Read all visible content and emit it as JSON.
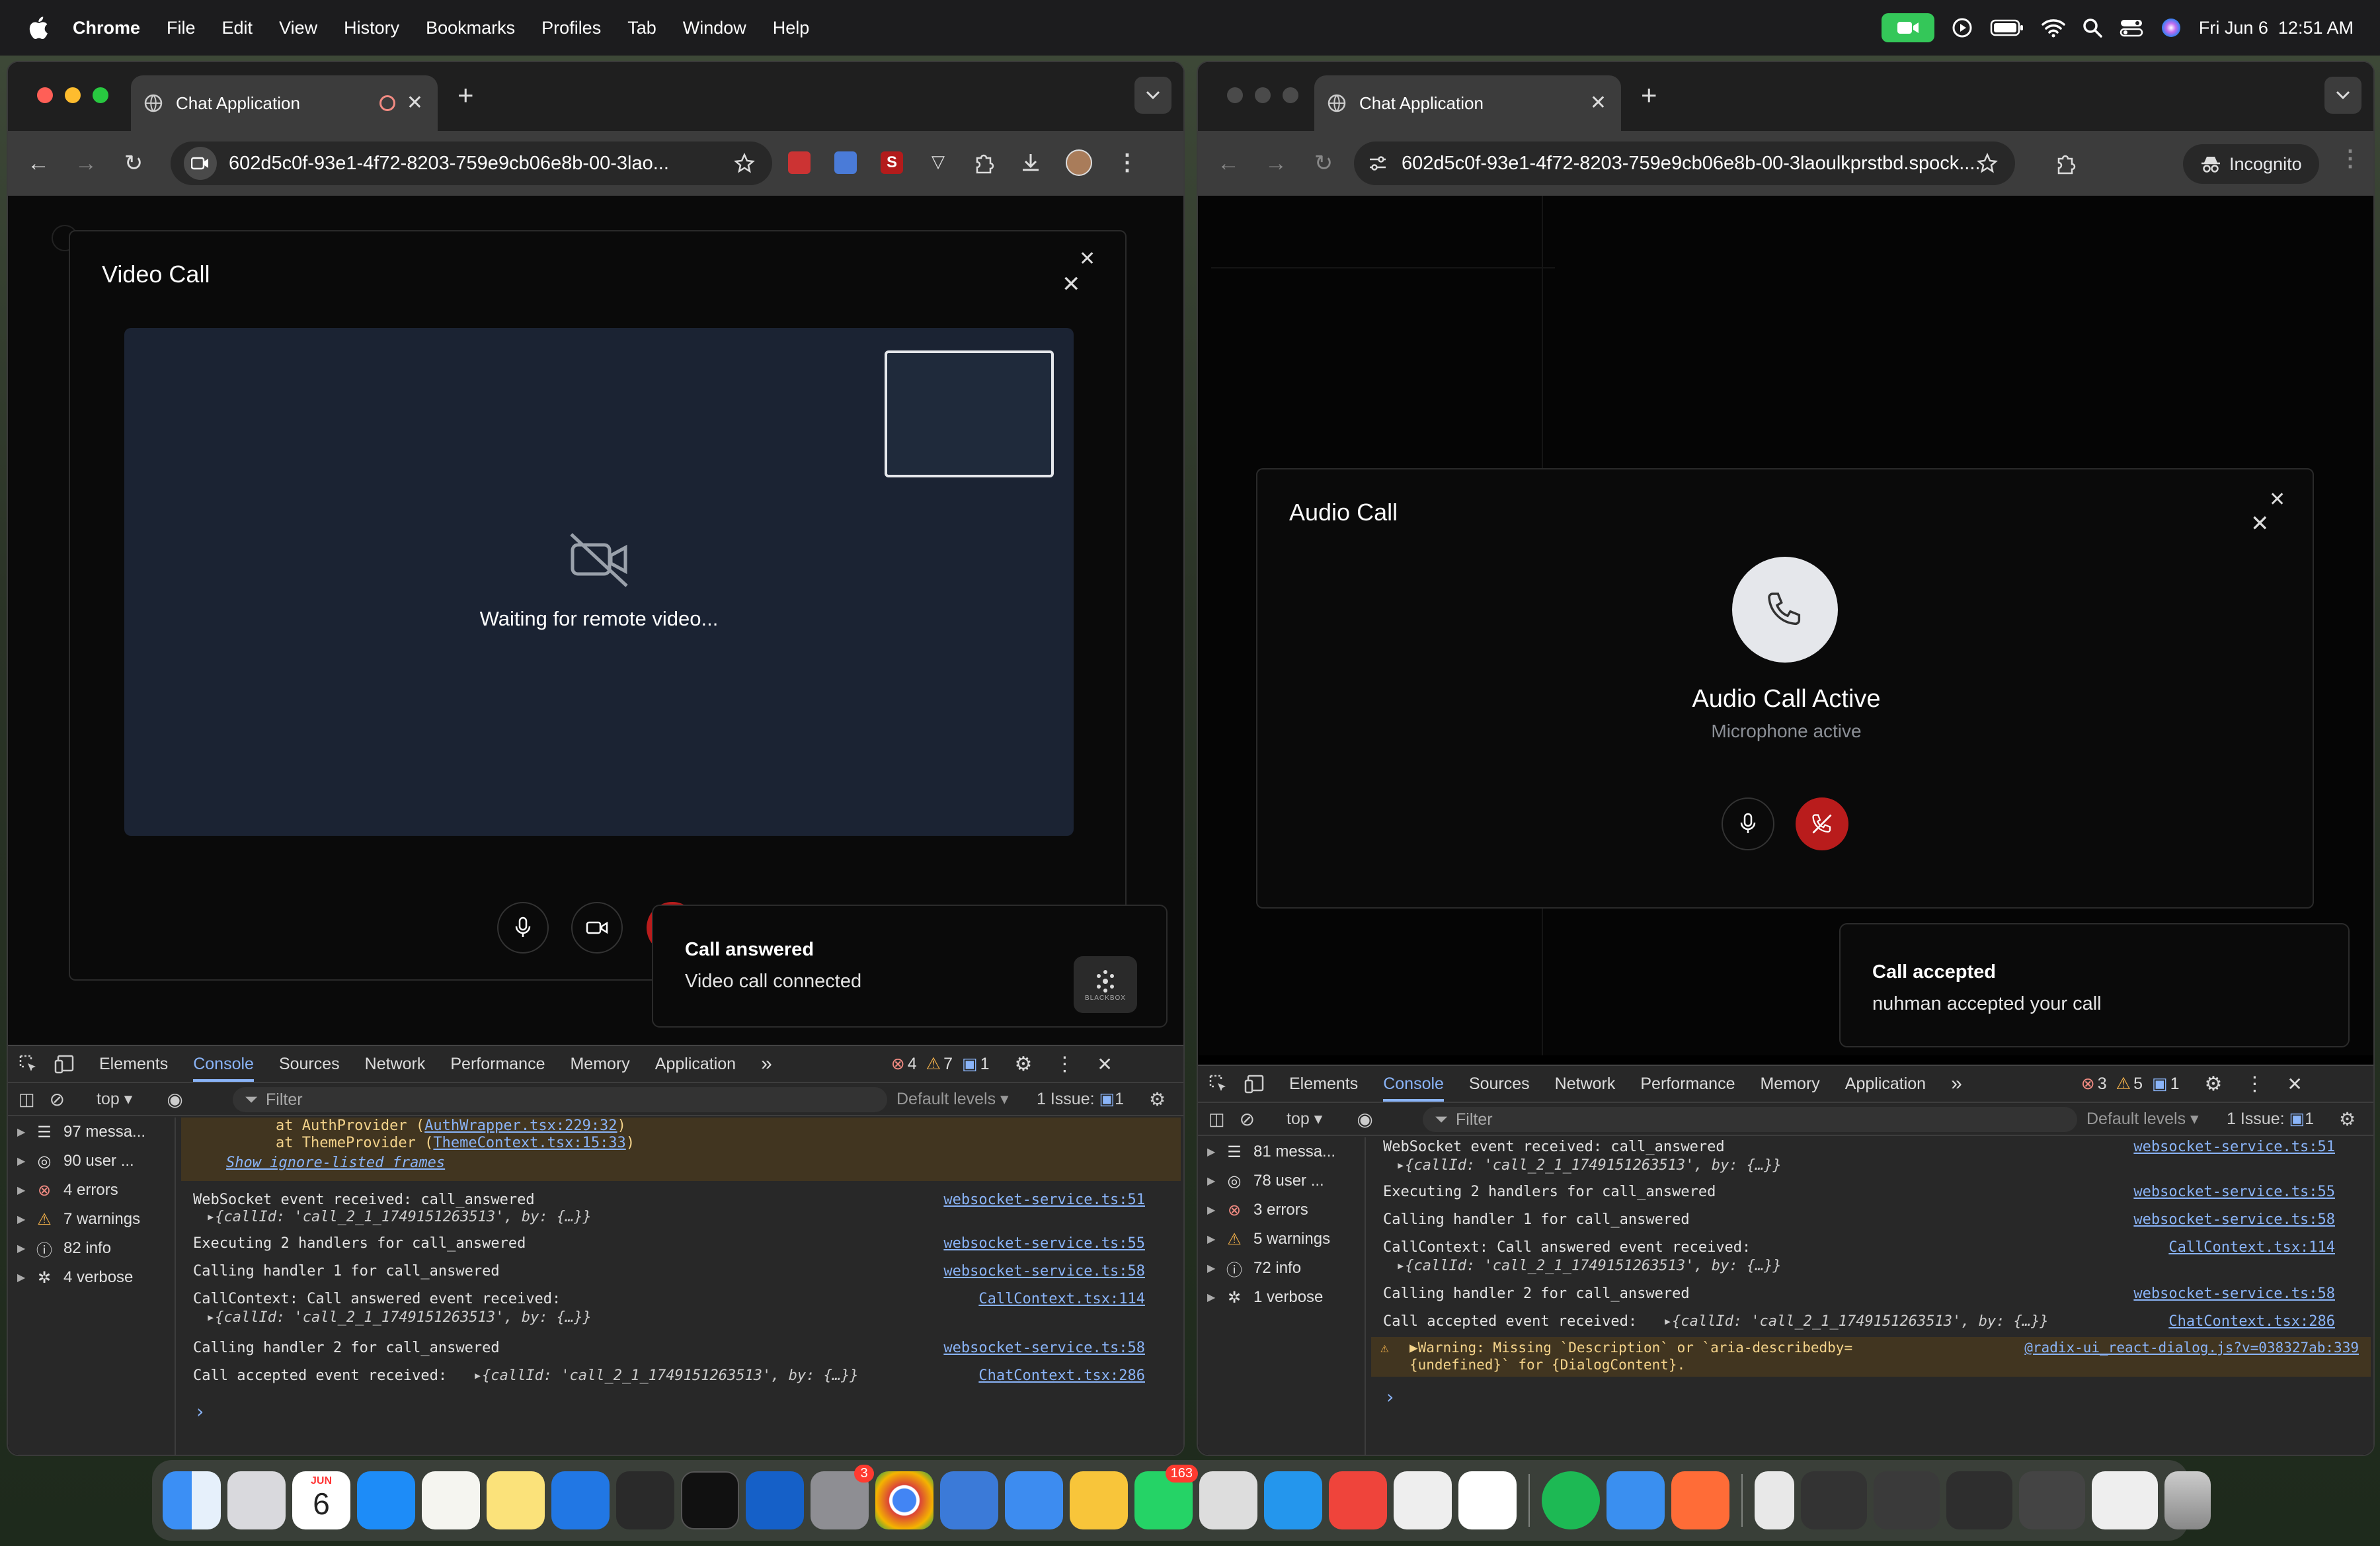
{
  "menubar": {
    "app": "Chrome",
    "items": [
      "File",
      "Edit",
      "View",
      "History",
      "Bookmarks",
      "Profiles",
      "Tab",
      "Window",
      "Help"
    ],
    "datetime": "Fri Jun 6  12:51 AM"
  },
  "left_window": {
    "tab_title": "Chat Application",
    "url": "602d5c0f-93e1-4f72-8203-759e9cb06e8b-00-3lao...",
    "modal": {
      "title": "Video Call",
      "waiting_text": "Waiting for remote video..."
    },
    "toast": {
      "title": "Call answered",
      "message": "Video call connected",
      "logo_text": "BLACKBOX"
    },
    "devtools": {
      "tabs": [
        "Elements",
        "Console",
        "Sources",
        "Network",
        "Performance",
        "Memory",
        "Application"
      ],
      "errors": "4",
      "warnings": "7",
      "infos": "1",
      "context": "top",
      "filter_placeholder": "Filter",
      "levels": "Default levels",
      "issues": "1 Issue:",
      "issues_count": "1",
      "sidebar": [
        {
          "label": "97 messa...",
          "icon": "list-icon"
        },
        {
          "label": "90 user ...",
          "icon": "user-icon"
        },
        {
          "label": "4 errors",
          "icon": "error-icon"
        },
        {
          "label": "7 warnings",
          "icon": "warning-icon"
        },
        {
          "label": "82 info",
          "icon": "info-icon"
        },
        {
          "label": "4 verbose",
          "icon": "bug-icon"
        }
      ],
      "stack": [
        "    at AuthProvider (",
        "AuthWrapper.tsx:229:32",
        ")",
        "    at ThemeProvider (",
        "ThemeContext.tsx:15:33",
        ")"
      ],
      "ignore_link": "Show ignore-listed frames",
      "logs": [
        {
          "text": "WebSocket event received: call_answered",
          "src": "websocket-service.ts:51",
          "obj": "{callId: 'call_2_1_1749151263513', by: {…}}"
        },
        {
          "text": "Executing 2 handlers for call_answered",
          "src": "websocket-service.ts:55"
        },
        {
          "text": "Calling handler 1 for call_answered",
          "src": "websocket-service.ts:58"
        },
        {
          "text": "CallContext: Call answered event received:",
          "src": "CallContext.tsx:114",
          "obj": "{callId: 'call_2_1_1749151263513', by: {…}}"
        },
        {
          "text": "Calling handler 2 for call_answered",
          "src": "websocket-service.ts:58"
        },
        {
          "text": "Call accepted event received:",
          "src": "ChatContext.tsx:286",
          "obj": "{callId: 'call_2_1_1749151263513', by: {…}}"
        }
      ]
    }
  },
  "right_window": {
    "tab_title": "Chat Application",
    "url": "602d5c0f-93e1-4f72-8203-759e9cb06e8b-00-3laoulkprstbd.spock....",
    "incognito": "Incognito",
    "modal": {
      "title": "Audio Call",
      "status": "Audio Call Active",
      "substatus": "Microphone active"
    },
    "toast": {
      "title": "Call accepted",
      "message": "nuhman accepted your call"
    },
    "devtools": {
      "tabs": [
        "Elements",
        "Console",
        "Sources",
        "Network",
        "Performance",
        "Memory",
        "Application"
      ],
      "errors": "3",
      "warnings": "5",
      "infos": "1",
      "context": "top",
      "filter_placeholder": "Filter",
      "levels": "Default levels",
      "issues": "1 Issue:",
      "issues_count": "1",
      "sidebar": [
        {
          "label": "81 messa...",
          "icon": "list-icon"
        },
        {
          "label": "78 user ...",
          "icon": "user-icon"
        },
        {
          "label": "3 errors",
          "icon": "error-icon"
        },
        {
          "label": "5 warnings",
          "icon": "warning-icon"
        },
        {
          "label": "72 info",
          "icon": "info-icon"
        },
        {
          "label": "1 verbose",
          "icon": "bug-icon"
        }
      ],
      "logs": [
        {
          "text": "WebSocket event received: call_answered",
          "src": "websocket-service.ts:51",
          "obj": "{callId: 'call_2_1_1749151263513', by: {…}}"
        },
        {
          "text": "Executing 2 handlers for call_answered",
          "src": "websocket-service.ts:55"
        },
        {
          "text": "Calling handler 1 for call_answered",
          "src": "websocket-service.ts:58"
        },
        {
          "text": "CallContext: Call answered event received:",
          "src": "CallContext.tsx:114",
          "obj": "{callId: 'call_2_1_1749151263513', by: {…}}"
        },
        {
          "text": "Calling handler 2 for call_answered",
          "src": "websocket-service.ts:58"
        },
        {
          "text": "Call accepted event received:",
          "src": "ChatContext.tsx:286",
          "obj": "{callId: 'call_2_1_1749151263513', by: {…}}"
        }
      ],
      "warning": {
        "line1": "▶Warning: Missing `Description` or `aria-describedby=",
        "line2": "{undefined}` for {DialogContent}.",
        "src": "@radix-ui_react-dialog.js?v=038327ab:339"
      }
    }
  },
  "dock": {
    "badges": {
      "settings": "3",
      "whatsapp": "163"
    },
    "calendar_month": "JUN",
    "calendar_day": "6"
  },
  "colors": {
    "accent": "#8ab4f8",
    "danger": "#b91c1c",
    "warning": "#f2b04a"
  }
}
